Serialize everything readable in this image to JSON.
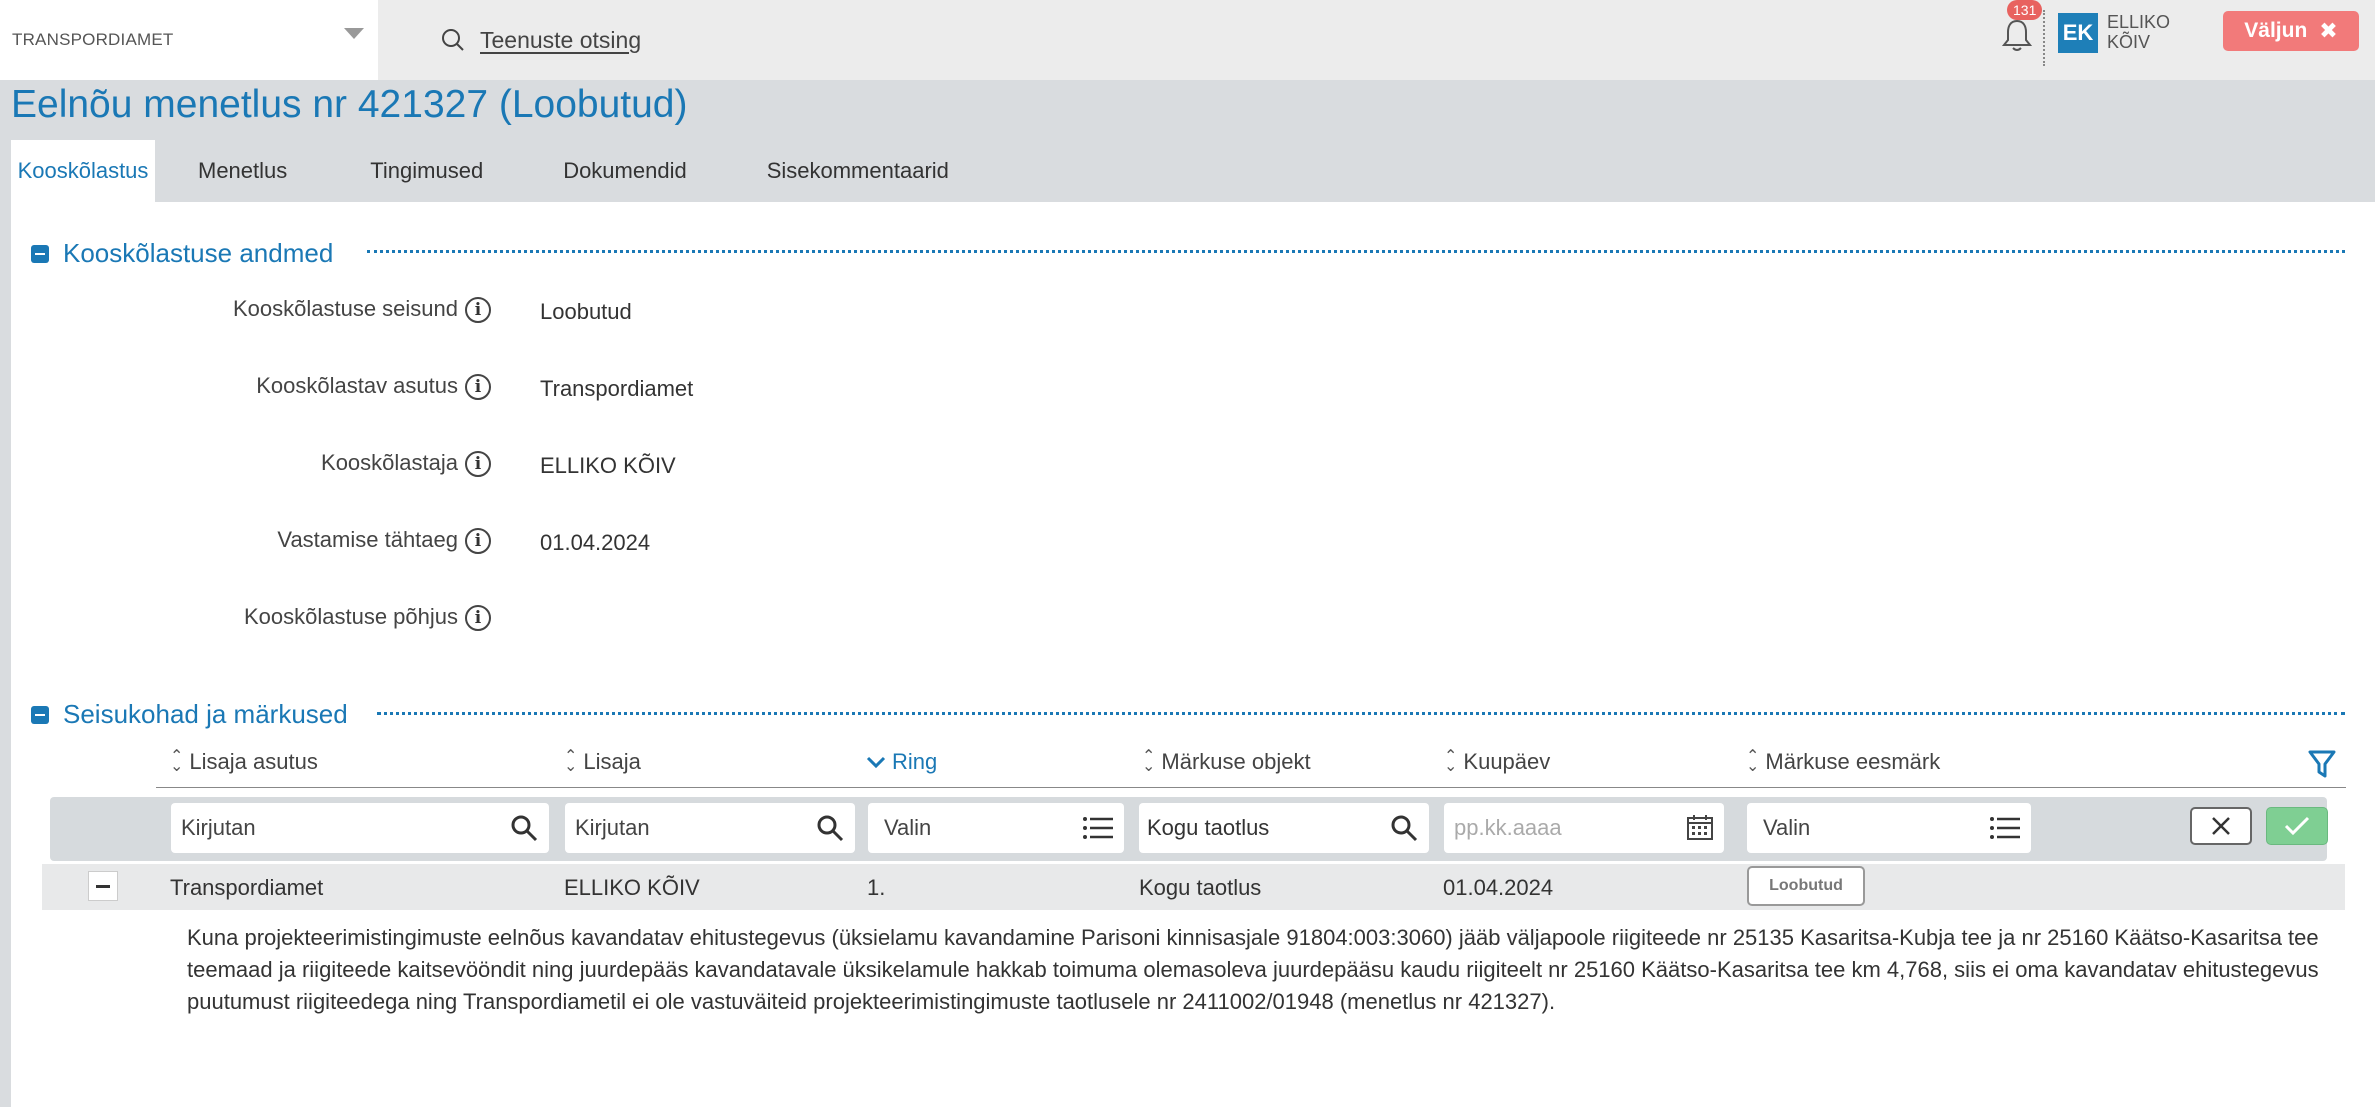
{
  "header": {
    "org": "TRANSPORDIAMET",
    "search_label": "Teenuste otsing",
    "notifications": "131",
    "avatar_initials": "EK",
    "user_first": "ELLIKO",
    "user_last": "KÕIV",
    "logout": "Väljun"
  },
  "page": {
    "title": "Eelnõu menetlus nr 421327 (Loobutud)",
    "tabs": [
      {
        "label": "Kooskõlastus",
        "active": true
      },
      {
        "label": "Menetlus"
      },
      {
        "label": "Tingimused"
      },
      {
        "label": "Dokumendid"
      },
      {
        "label": "Sisekommentaarid"
      }
    ]
  },
  "section1": {
    "title": "Kooskõlastuse andmed",
    "fields": [
      {
        "label": "Kooskõlastuse seisund",
        "value": "Loobutud"
      },
      {
        "label": "Kooskõlastav asutus",
        "value": "Transpordiamet"
      },
      {
        "label": "Kooskõlastaja",
        "value": "ELLIKO KÕIV"
      },
      {
        "label": "Vastamise tähtaeg",
        "value": "01.04.2024"
      },
      {
        "label": "Kooskõlastuse põhjus",
        "value": ""
      }
    ]
  },
  "section2": {
    "title": "Seisukohad ja märkused",
    "columns": [
      "Lisaja asutus",
      "Lisaja",
      "Ring",
      "Märkuse objekt",
      "Kuupäev",
      "Märkuse eesmärk"
    ],
    "filters": {
      "f1": "Kirjutan",
      "f2": "Kirjutan",
      "f3": "Valin",
      "f4": "Kogu taotlus",
      "f5": "pp.kk.aaaa",
      "f6": "Valin"
    },
    "row": {
      "asutus": "Transpordiamet",
      "lisaja": "ELLIKO KÕIV",
      "ring": "1.",
      "objekt": "Kogu taotlus",
      "kuupaev": "01.04.2024",
      "status": "Loobutud",
      "comment": "Kuna projekteerimistingimuste eelnõus kavandatav ehitustegevus (üksielamu kavandamine Parisoni kinnisasjale    91804:003:3060) jääb väljapoole riigiteede nr 25135 Kasaritsa-Kubja tee ja nr 25160 Käätso-Kasaritsa tee teemaad ja riigiteede kaitsevööndit ning juurdepääs kavandatavale üksikelamule hakkab toimuma olemasoleva juurdepääsu kaudu riigiteelt nr 25160 Käätso-Kasaritsa tee km 4,768, siis ei oma kavandatav ehitustegevus puutumust riigiteedega ning Transpordiametil ei ole vastuväiteid projekteerimistingimuste taotlusele nr 2411002/01948 (menetlus nr 421327)."
    }
  },
  "colors": {
    "accent": "#1a78b5",
    "logout": "#f27a7a",
    "confirm": "#7fcf93"
  }
}
